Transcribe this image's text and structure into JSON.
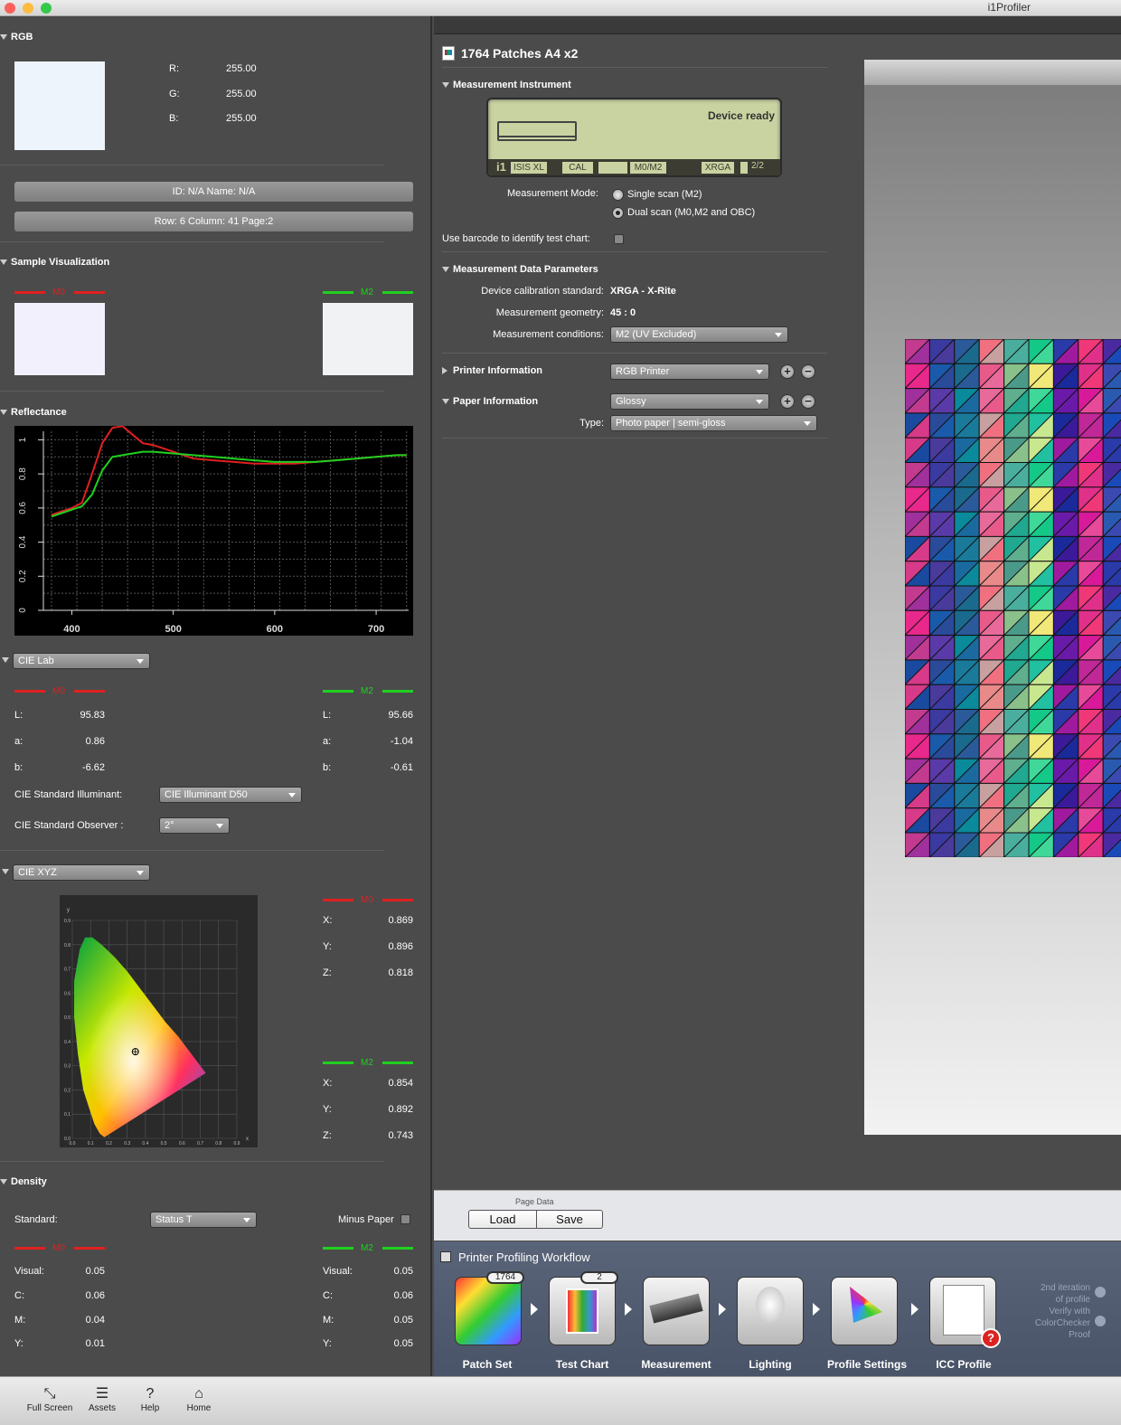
{
  "window": {
    "title": "i1Profiler"
  },
  "rgb": {
    "title": "RGB",
    "r_label": "R:",
    "r": "255.00",
    "g_label": "G:",
    "g": "255.00",
    "b_label": "B:",
    "b": "255.00",
    "id_bar": "ID: N/A    Name: N/A",
    "pos_bar": "Row: 6    Column: 41    Page:2"
  },
  "sample": {
    "title": "Sample Visualization",
    "m0": "M0",
    "m2": "M2"
  },
  "reflectance": {
    "title": "Reflectance"
  },
  "chart_data": {
    "type": "line",
    "title": "Reflectance",
    "xlim": [
      372,
      732
    ],
    "ylim": [
      0,
      1.05
    ],
    "xticks": [
      400,
      500,
      600,
      700
    ],
    "yticks": [
      0,
      0.2,
      0.4,
      0.6,
      0.8,
      1
    ],
    "ytick_labels": [
      "0",
      "0.2",
      "0.4",
      "0.6",
      "0.8",
      "1"
    ],
    "grid": true,
    "series": [
      {
        "name": "M0",
        "color": "#e02020",
        "x": [
          380,
          390,
          400,
          410,
          420,
          430,
          440,
          450,
          460,
          470,
          480,
          500,
          520,
          540,
          560,
          580,
          600,
          620,
          640,
          660,
          680,
          700,
          720,
          730
        ],
        "y": [
          0.56,
          0.58,
          0.6,
          0.63,
          0.8,
          0.98,
          1.07,
          1.08,
          1.03,
          0.98,
          0.97,
          0.93,
          0.89,
          0.88,
          0.87,
          0.86,
          0.86,
          0.86,
          0.87,
          0.88,
          0.89,
          0.9,
          0.91,
          0.91
        ]
      },
      {
        "name": "M2",
        "color": "#20d020",
        "x": [
          380,
          390,
          400,
          410,
          420,
          430,
          440,
          450,
          460,
          470,
          480,
          500,
          520,
          540,
          560,
          580,
          600,
          620,
          640,
          660,
          680,
          700,
          720,
          730
        ],
        "y": [
          0.55,
          0.57,
          0.59,
          0.61,
          0.68,
          0.82,
          0.9,
          0.91,
          0.92,
          0.93,
          0.93,
          0.92,
          0.91,
          0.9,
          0.89,
          0.88,
          0.87,
          0.87,
          0.87,
          0.88,
          0.89,
          0.9,
          0.91,
          0.91
        ]
      }
    ]
  },
  "lab": {
    "dropdown": "CIE Lab",
    "m0": "M0",
    "m2": "M2",
    "l_label": "L:",
    "a_label": "a:",
    "b_label": "b:",
    "m0_L": "95.83",
    "m0_a": "0.86",
    "m0_b": "-6.62",
    "m2_L": "95.66",
    "m2_a": "-1.04",
    "m2_b": "-0.61",
    "illuminant_label": "CIE Standard Illuminant:",
    "illuminant": "CIE Illuminant D50",
    "observer_label": "CIE Standard Observer :",
    "observer": "2°"
  },
  "xyz": {
    "dropdown": "CIE XYZ",
    "m0": "M0",
    "m2": "M2",
    "x_label": "X:",
    "y_label": "Y:",
    "z_label": "Z:",
    "m0_X": "0.869",
    "m0_Y": "0.896",
    "m0_Z": "0.818",
    "m2_X": "0.854",
    "m2_Y": "0.892",
    "m2_Z": "0.743",
    "axis_x": "x",
    "axis_y": "y",
    "xtick_labels": [
      "0.0",
      "0.1",
      "0.2",
      "0.3",
      "0.4",
      "0.5",
      "0.6",
      "0.7",
      "0.8",
      "0.9"
    ],
    "ytick_labels": [
      "0.0",
      "0.1",
      "0.2",
      "0.3",
      "0.4",
      "0.5",
      "0.6",
      "0.7",
      "0.8",
      "0.9"
    ]
  },
  "density": {
    "title": "Density",
    "standard_label": "Standard:",
    "standard": "Status T",
    "minus_paper": "Minus Paper",
    "m0": "M0",
    "m2": "M2",
    "visual_label": "Visual:",
    "c_label": "C:",
    "m_label": "M:",
    "y_label": "Y:",
    "m0_visual": "0.05",
    "m0_c": "0.06",
    "m0_m": "0.04",
    "m0_y": "0.01",
    "m2_visual": "0.05",
    "m2_c": "0.06",
    "m2_m": "0.05",
    "m2_y": "0.05"
  },
  "doc": {
    "title": "1764 Patches A4 x2"
  },
  "instrument": {
    "title": "Measurement Instrument",
    "status": "Device ready",
    "tags": [
      "ISIS XL",
      "CAL",
      "M0/M2",
      "XRGA",
      "2/2"
    ],
    "mode_label": "Measurement Mode:",
    "mode1": "Single scan (M2)",
    "mode2": "Dual scan (M0,M2 and OBC)",
    "barcode_label": "Use barcode to identify test chart:"
  },
  "params": {
    "title": "Measurement Data Parameters",
    "calib_label": "Device calibration standard:",
    "calib": "XRGA - X-Rite",
    "geom_label": "Measurement geometry:",
    "geom": "45 : 0",
    "cond_label": "Measurement conditions:",
    "cond": "M2 (UV Excluded)"
  },
  "printer": {
    "title": "Printer Information",
    "value": "RGB Printer"
  },
  "paper": {
    "title": "Paper Information",
    "value": "Glossy",
    "type_label": "Type:",
    "type": "Photo paper | semi-gloss"
  },
  "pagedata": {
    "label": "Page Data",
    "load": "Load",
    "save": "Save"
  },
  "workflow": {
    "title": "Printer Profiling Workflow",
    "items": [
      {
        "label": "Patch Set",
        "badge": "1764"
      },
      {
        "label": "Test Chart",
        "badge": "2"
      },
      {
        "label": "Measurement"
      },
      {
        "label": "Lighting"
      },
      {
        "label": "Profile Settings"
      },
      {
        "label": "ICC Profile"
      }
    ],
    "note1": "2nd iteration",
    "note2": "of profile",
    "note3": "Verify with",
    "note4": "ColorChecker",
    "note5": "Proof"
  },
  "bottom": {
    "items": [
      {
        "label": "Full Screen",
        "icon": "fullscreen-icon"
      },
      {
        "label": "Assets",
        "icon": "list-icon"
      },
      {
        "label": "Help",
        "icon": "help-icon"
      },
      {
        "label": "Home",
        "icon": "home-icon"
      }
    ]
  },
  "patches": {
    "rows": 21,
    "cols": 9,
    "colors": [
      "#c23b8f",
      "#2a4a9a",
      "#1a6a8e",
      "#e88a8a",
      "#5fae8e",
      "#14c888",
      "#1a2a9a",
      "#e0308a",
      "#2a3aa8"
    ]
  }
}
